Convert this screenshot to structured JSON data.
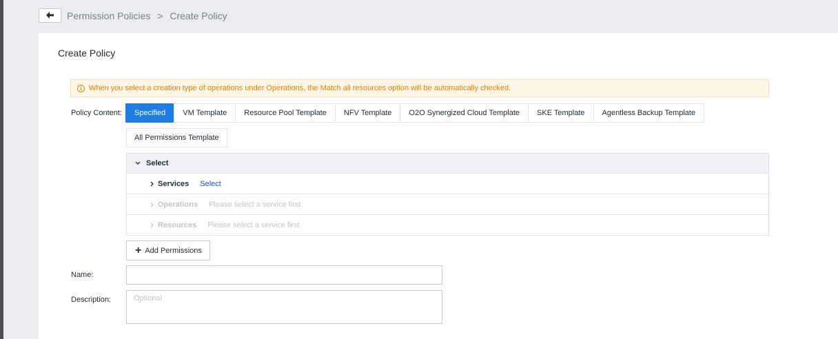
{
  "breadcrumb": {
    "parent": "Permission Policies",
    "separator": ">",
    "current": "Create Policy"
  },
  "page": {
    "title": "Create Policy"
  },
  "notice": {
    "text": "When you select a creation type of operations under Operations, the Match all resources option will be automatically checked."
  },
  "policy_content": {
    "label": "Policy Content:",
    "tabs": [
      {
        "label": "Specified",
        "active": true
      },
      {
        "label": "VM Template"
      },
      {
        "label": "Resource Pool Template"
      },
      {
        "label": "NFV Template"
      },
      {
        "label": "O2O Synergized Cloud Template"
      },
      {
        "label": "SKE Template"
      },
      {
        "label": "Agentless Backup Template"
      }
    ],
    "tab_row2": "All Permissions Template"
  },
  "select_panel": {
    "header": "Select",
    "services": {
      "label": "Services",
      "link": "Select"
    },
    "operations": {
      "label": "Operations",
      "hint": "Please select a service first."
    },
    "resources": {
      "label": "Resources",
      "hint": "Please select a service first."
    }
  },
  "add_permissions": {
    "label": "Add Permissions"
  },
  "name_field": {
    "label": "Name:",
    "value": "",
    "placeholder": ""
  },
  "description_field": {
    "label": "Description:",
    "placeholder": "Optional"
  },
  "colors": {
    "accent": "#1e7ee6",
    "link": "#1e50c8",
    "warning": "#f07c00",
    "warning_bg": "#fff7e6"
  }
}
